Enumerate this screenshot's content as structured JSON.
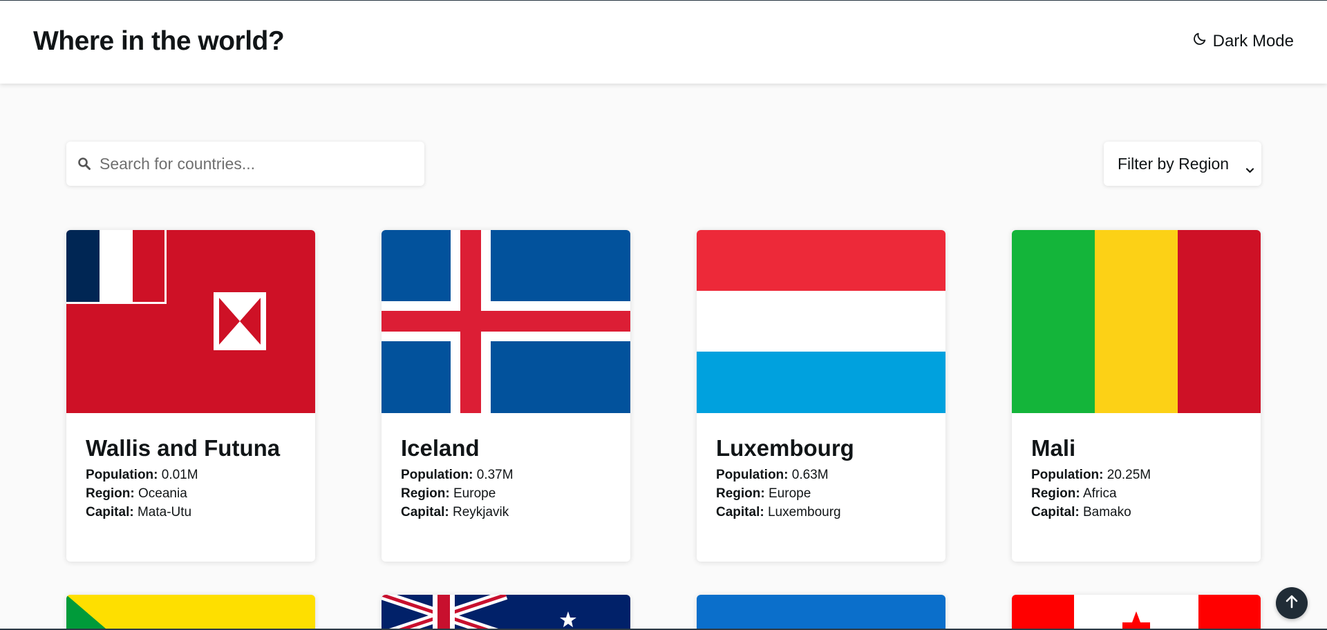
{
  "header": {
    "title": "Where in the world?",
    "theme_toggle_label": "Dark Mode",
    "theme_toggle_icon": "moon-icon"
  },
  "search": {
    "placeholder": "Search for countries...",
    "value": "",
    "icon": "search-icon"
  },
  "filter": {
    "selected": "Filter by Region",
    "icon": "chevron-down-icon"
  },
  "labels": {
    "population": "Population:",
    "region": "Region:",
    "capital": "Capital:"
  },
  "countries": [
    {
      "name": "Wallis and Futuna",
      "population": "0.01M",
      "region": "Oceania",
      "capital": "Mata-Utu"
    },
    {
      "name": "Iceland",
      "population": "0.37M",
      "region": "Europe",
      "capital": "Reykjavik"
    },
    {
      "name": "Luxembourg",
      "population": "0.63M",
      "region": "Europe",
      "capital": "Luxembourg"
    },
    {
      "name": "Mali",
      "population": "20.25M",
      "region": "Africa",
      "capital": "Bamako"
    }
  ],
  "colors": {
    "background": "#fafafa",
    "card": "#ffffff",
    "text": "#111517",
    "scroll_button": "#202c36"
  },
  "scroll_top_icon": "arrow-up-icon"
}
